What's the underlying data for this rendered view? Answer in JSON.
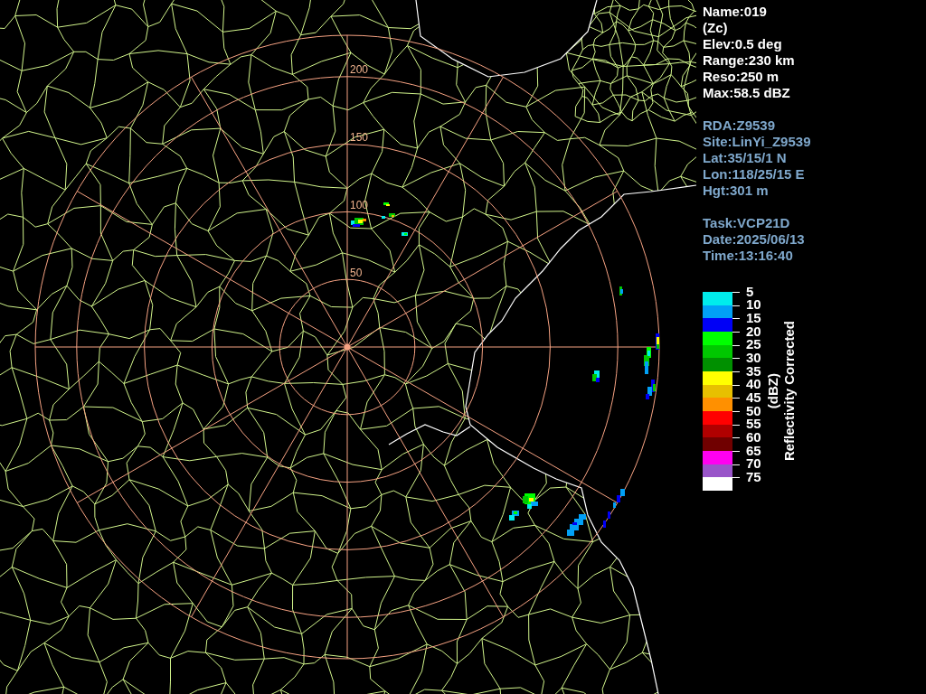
{
  "info_panel": {
    "groups": [
      {
        "kind": "product",
        "lines": [
          "Name:019",
          "(Zc)",
          "Elev:0.5 deg",
          "Range:230 km",
          "Reso:250 m",
          "Max:58.5 dBZ"
        ]
      },
      {
        "kind": "site",
        "lines": [
          "RDA:Z9539",
          "Site:LinYi_Z9539",
          "Lat:35/15/1 N",
          "Lon:118/25/15 E",
          "Hgt:301 m"
        ]
      },
      {
        "kind": "task",
        "lines": [
          "Task:VCP21D",
          "Date:2025/06/13",
          "Time:13:16:40"
        ]
      }
    ]
  },
  "radar_display": {
    "range_rings": [
      {
        "label": "200"
      },
      {
        "label": "150"
      },
      {
        "label": "100"
      },
      {
        "label": "50"
      }
    ]
  },
  "colorbar": {
    "unit": "(dBZ)",
    "title": "Reflectivity Corrected",
    "items": [
      {
        "label": "5",
        "color": "#00ecec"
      },
      {
        "label": "10",
        "color": "#01a0f6"
      },
      {
        "label": "15",
        "color": "#0000f6"
      },
      {
        "label": "20",
        "color": "#00ff00"
      },
      {
        "label": "25",
        "color": "#00c800"
      },
      {
        "label": "30",
        "color": "#009000"
      },
      {
        "label": "35",
        "color": "#ffff00"
      },
      {
        "label": "40",
        "color": "#e7c000"
      },
      {
        "label": "45",
        "color": "#ff9000"
      },
      {
        "label": "50",
        "color": "#ff0000"
      },
      {
        "label": "55",
        "color": "#b00000"
      },
      {
        "label": "60",
        "color": "#700000"
      },
      {
        "label": "65",
        "color": "#ff00f0"
      },
      {
        "label": "70",
        "color": "#9955c9"
      },
      {
        "label": "75",
        "color": "#ffffff"
      }
    ]
  }
}
